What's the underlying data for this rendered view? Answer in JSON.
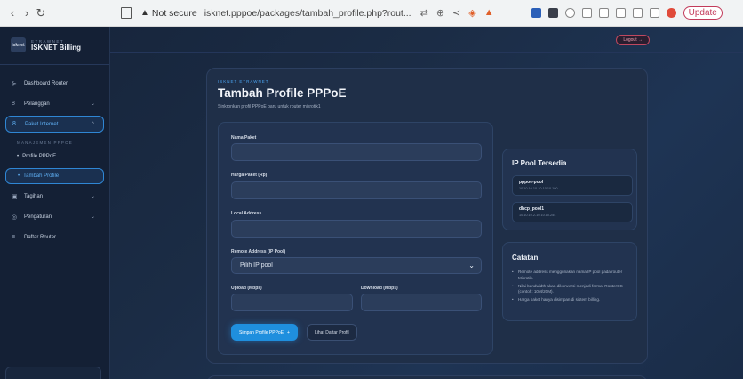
{
  "browser": {
    "back_glyph": "‹",
    "forward_glyph": "›",
    "reload_glyph": "↻",
    "security_glyph": "▲",
    "security_label": "Not secure",
    "url": "isknet.pppoe/packages/tambah_profile.php?rout...",
    "update_label": "Update",
    "icons": [
      "translate-icon",
      "zoom-icon",
      "share-icon",
      "brave-shield-icon",
      "brave-rewards-icon"
    ]
  },
  "sidebar": {
    "brand_sub": "ETRAWNET",
    "brand_name": "ISKNET Billing",
    "logo_text": "isknet",
    "items": [
      {
        "label": "Dashboard Router",
        "icon": "dashboard-icon",
        "glyph": "⊱"
      },
      {
        "label": "Pelanggan",
        "icon": "users-icon",
        "glyph": "8",
        "chevron": "⌄"
      },
      {
        "label": "Paket Internet",
        "icon": "package-icon",
        "glyph": "8",
        "chevron": "^"
      }
    ],
    "section_label": "MANAJEMEN PPPOE",
    "sub_items": [
      {
        "label": "Profile PPPoE",
        "bullet": "•"
      },
      {
        "label": "Tambah Profile",
        "bullet": "•"
      }
    ],
    "items_after": [
      {
        "label": "Tagihan",
        "icon": "receipt-icon",
        "glyph": "▣",
        "chevron": "⌄"
      },
      {
        "label": "Pengaturan",
        "icon": "settings-icon",
        "glyph": "◎",
        "chevron": "⌄"
      },
      {
        "label": "Daftar Router",
        "icon": "list-icon",
        "glyph": "≡"
      }
    ]
  },
  "topbar": {
    "logout_label": "Logout →"
  },
  "page": {
    "breadcrumb": "ISKNET ETRAWNET",
    "title": "Tambah Profile PPPoE",
    "subtitle": "Sinkronkan profil PPPoE baru untuk router mikrotik1"
  },
  "form": {
    "name_label": "Nama Paket",
    "price_label": "Harga Paket (Rp)",
    "local_label": "Local Address",
    "remote_label": "Remote Address (IP Pool)",
    "remote_selected": "Pilih IP pool",
    "upload_label": "Upload (Mbps)",
    "download_label": "Download (Mbps)",
    "submit_label": "Simpan Profile PPPoE",
    "submit_glyph": "+",
    "list_label": "Lihat Daftar Profil"
  },
  "ip_pool": {
    "title": "IP Pool Tersedia",
    "pools": [
      {
        "name": "pppoe-pool",
        "range": "10.10.10.10-10.10.10.100"
      },
      {
        "name": "dhcp_pool1",
        "range": "10.10.10.2-10.10.10.254"
      }
    ]
  },
  "notes": {
    "title": "Catatan",
    "items": [
      "Remote address menggunakan nama IP pool pada router Mikrotik.",
      "Nilai bandwidth akan dikonversi menjadi format RouterOS (contoh: 10M/20M).",
      "Harga paket hanya disimpan di sistem billing."
    ]
  },
  "colors": {
    "accent": "#1f8fde",
    "background": "#1b2c45",
    "danger": "#c0485f"
  }
}
